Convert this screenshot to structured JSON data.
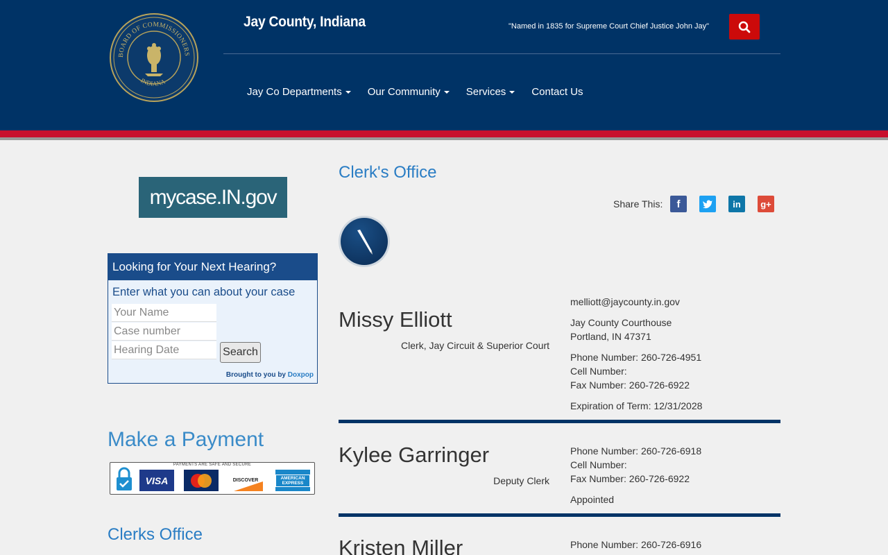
{
  "header": {
    "title": "Jay County, Indiana",
    "tagline": "\"Named in 1835 for Supreme Court Chief Justice John Jay\"",
    "seal_text": "BOARD OF COMMISSIONERS OF JAY COUNTY",
    "seal_bottom": "INDIANA",
    "nav": [
      {
        "label": "Jay Co Departments",
        "dropdown": true
      },
      {
        "label": "Our Community",
        "dropdown": true
      },
      {
        "label": "Services",
        "dropdown": true
      },
      {
        "label": "Contact Us",
        "dropdown": false
      }
    ]
  },
  "sidebar": {
    "mycase_label": "mycase.IN.gov",
    "hearing": {
      "title": "Looking for Your Next Hearing?",
      "subtitle": "Enter what you can about your case",
      "name_placeholder": "Your Name",
      "case_placeholder": "Case number",
      "date_placeholder": "Hearing Date",
      "search_label": "Search",
      "brought_by": "Brought to you by",
      "brought_link": "Doxpop"
    },
    "payment_heading": "Make a Payment",
    "payment_caption": "PAYMENTS ARE SAFE AND SECURE",
    "cards": [
      "VISA",
      "MasterCard",
      "DISCOVER",
      "AMERICAN EXPRESS"
    ],
    "clerks_office_heading": "Clerks Office"
  },
  "main": {
    "title": "Clerk's Office",
    "share_label": "Share This:",
    "social": [
      "f",
      "t",
      "in",
      "g+"
    ],
    "people": [
      {
        "name": "Missy Elliott",
        "role": "Clerk, Jay Circuit & Superior Court",
        "email": "melliott@jaycounty.in.gov",
        "address1": "Jay County Courthouse",
        "address2": "Portland, IN 47371",
        "phone": "Phone Number: 260-726-4951",
        "cell": "Cell Number:",
        "fax": "Fax Number: 260-726-6922",
        "term": "Expiration of Term: 12/31/2028"
      },
      {
        "name": "Kylee Garringer",
        "role": "Deputy Clerk",
        "phone": "Phone Number: 260-726-6918",
        "cell": "Cell Number:",
        "fax": "Fax Number: 260-726-6922",
        "term": "Appointed"
      },
      {
        "name": "Kristen Miller",
        "phone": "Phone Number: 260-726-6916"
      }
    ]
  },
  "colors": {
    "header_bg": "#003366",
    "accent_red": "#c8102e",
    "link_blue": "#2a7dc4"
  }
}
